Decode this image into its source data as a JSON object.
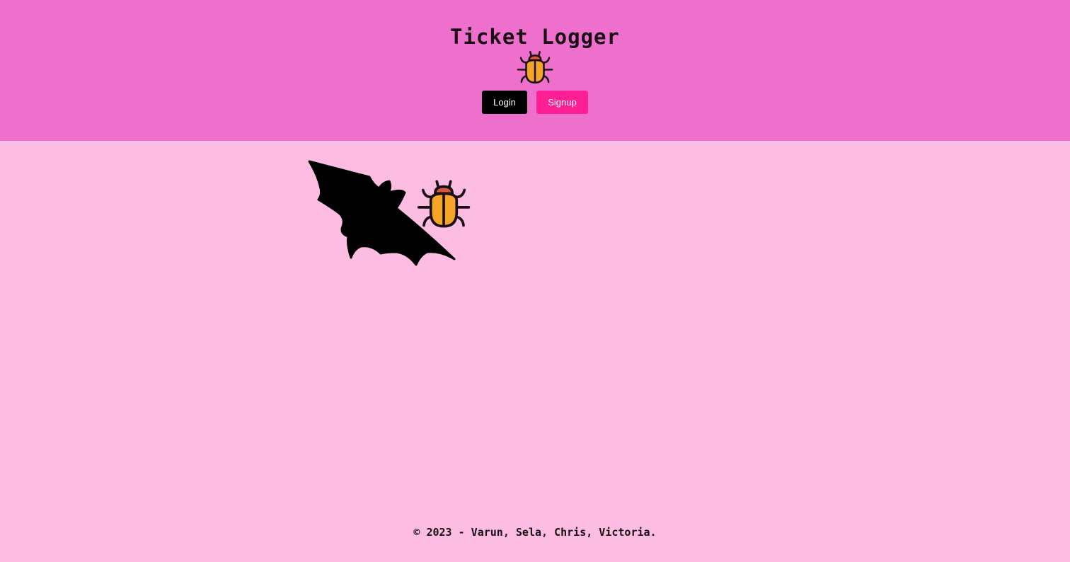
{
  "header": {
    "title": "Ticket Logger",
    "logo_icon": "bug-icon",
    "login_label": "Login",
    "signup_label": "Signup"
  },
  "main": {
    "illustration_icons": [
      "bat-icon",
      "bug-icon"
    ]
  },
  "footer": {
    "text": "© 2023 - Varun, Sela, Chris, Victoria."
  },
  "colors": {
    "header_bg": "#ef6fcd",
    "page_bg": "#fdbce2",
    "login_bg": "#000000",
    "signup_bg": "#fe1f94",
    "bug_body": "#f5a427",
    "bug_head": "#d9573a"
  }
}
